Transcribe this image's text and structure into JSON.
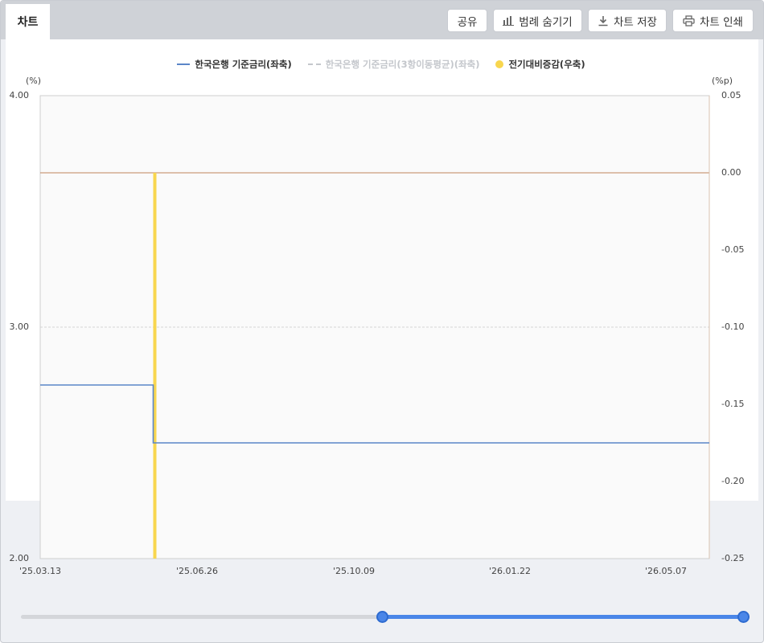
{
  "tab": {
    "label": "차트"
  },
  "toolbar": {
    "share_label": "공유",
    "hide_legend_label": "범례 숨기기",
    "save_label": "차트 저장",
    "print_label": "차트 인쇄"
  },
  "legend": {
    "items": [
      {
        "label": "한국은행 기준금리(좌축)",
        "style": "solid",
        "color": "#5b86c8",
        "enabled": true
      },
      {
        "label": "한국은행 기준금리(3항이동평균)(좌축)",
        "style": "dashed",
        "color": "#c4c7cc",
        "enabled": false
      },
      {
        "label": "전기대비증감(우축)",
        "style": "dot",
        "color": "#f8d64e",
        "enabled": true
      }
    ]
  },
  "axes": {
    "left_unit": "(%)",
    "right_unit": "(%p)",
    "left_ticks": [
      "4.00",
      "3.00",
      "2.00"
    ],
    "right_ticks": [
      "0.05",
      "0.00",
      "-0.05",
      "-0.10",
      "-0.15",
      "-0.20",
      "-0.25"
    ],
    "x_ticks": [
      "'25.03.13",
      "'25.06.26",
      "'25.10.09",
      "'26.01.22",
      "'26.05.07"
    ]
  },
  "chart_data": {
    "type": "line",
    "x_range": [
      "2025-03-13",
      "2026-06-12"
    ],
    "y_left_range": [
      2.0,
      4.0
    ],
    "y_right_range": [
      -0.25,
      0.05
    ],
    "series": [
      {
        "name": "한국은행 기준금리(좌축)",
        "axis": "left",
        "type": "step",
        "color": "#5b86c8",
        "x": [
          "2025-03-13",
          "2025-05-29",
          "2026-06-12"
        ],
        "values": [
          2.75,
          2.5,
          2.5
        ]
      },
      {
        "name": "전기대비증감(우축)",
        "axis": "right",
        "type": "bar",
        "color": "#f8d64e",
        "x": [
          "2025-05-29"
        ],
        "values": [
          -0.25
        ]
      }
    ],
    "zero_line_color": "#c0845a",
    "grid": "horizontal",
    "legend_position": "top"
  },
  "slider": {
    "start_fraction": 0.5,
    "end_fraction": 1.0
  }
}
